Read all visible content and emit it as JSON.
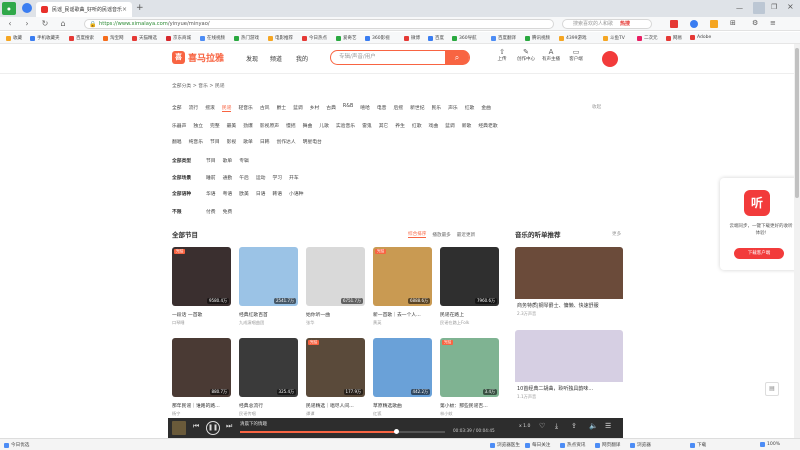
{
  "browser": {
    "tabs": [
      {
        "title": "民谣_民谣歌曲_好听的民谣音乐..."
      },
      {
        "title": "新标签页"
      }
    ],
    "url_scheme": "https://",
    "url_host": "www.ximalaya.com",
    "url_path": "/yinyue/minyao/",
    "search_placeholder": "搜索喜欢的人和歌",
    "hot_label": "热搜",
    "bookmarks": [
      "收藏",
      "手机收藏夹",
      "百度搜索",
      "淘宝网",
      "天猫精选",
      "京东商城",
      "在线视频",
      "热门游戏",
      "电影推荐",
      "今日热点",
      "爱奇艺",
      "360影视",
      "微博",
      "百度",
      "360导航",
      "百度翻译",
      "腾讯视频",
      "4399游戏",
      "斗鱼TV",
      "二次元",
      "网易",
      "Adobe"
    ]
  },
  "site": {
    "logo_text": "喜马拉雅",
    "logo_mark": "喜",
    "nav": [
      "发现",
      "频道",
      "我的"
    ],
    "search_placeholder": "专辑/声音/用户",
    "header_icons": [
      {
        "name": "上传",
        "icon": "upload-icon"
      },
      {
        "name": "创作中心",
        "icon": "create-icon"
      },
      {
        "name": "有声主播",
        "icon": "anchor-icon"
      },
      {
        "name": "客户端",
        "icon": "client-icon"
      }
    ],
    "breadcrumb": [
      "全部分类",
      "音乐",
      "民谣"
    ]
  },
  "categories": {
    "row1": [
      "全部",
      "流行",
      "摇滚",
      "民谣",
      "轻音乐",
      "古风",
      "爵士",
      "蓝调",
      "乡村",
      "古典",
      "R&B",
      "嘻哈",
      "电音",
      "后摇",
      "新世纪",
      "民乐",
      "声乐",
      "红歌",
      "金曲"
    ],
    "row1_active": "民谣",
    "row1_more": "收起",
    "row2": [
      "乐器声",
      "独立",
      "完整",
      "最美",
      "劲爆",
      "影视原声",
      "慢摇",
      "舞曲",
      "儿歌",
      "实验音乐",
      "雷鬼",
      "其它",
      "养生",
      "红歌",
      "戏曲",
      "蓝调",
      "新歌",
      "经典老歌"
    ],
    "row3": [
      "翻唱",
      "纯音乐",
      "节目",
      "影视",
      "歌单",
      "日韩",
      "创作达人",
      "明星电台"
    ],
    "filters": [
      {
        "label": "全部类型",
        "options": [
          "节目",
          "歌单",
          "专辑"
        ]
      },
      {
        "label": "全部场景",
        "options": [
          "睡前",
          "通勤",
          "午后",
          "运动",
          "学习",
          "开车"
        ]
      },
      {
        "label": "全部语种",
        "options": [
          "华语",
          "粤语",
          "欧美",
          "日语",
          "韩语",
          "小语种"
        ]
      },
      {
        "label": "不限",
        "options": [
          "付费",
          "免费"
        ]
      }
    ]
  },
  "section": {
    "title": "全部节目",
    "sorts": [
      "综合排序",
      "播放最多",
      "最近更新"
    ],
    "sort_active": "综合排序"
  },
  "albums": [
    {
      "title": "一段话 一首歌",
      "sub": "口琴睡",
      "count": "9580.4万",
      "tag": "完结",
      "color": "#3a2f2f"
    },
    {
      "title": "经典红歌百首",
      "sub": "九成演唱曲团",
      "count": "2541.7万",
      "tag": "",
      "color": "#9bc3e6"
    },
    {
      "title": "始你听一曲",
      "sub": "张华",
      "count": "6751.7万",
      "tag": "",
      "color": "#d9d9d9"
    },
    {
      "title": "新一首歌｜去一个人...",
      "sub": "黄英",
      "count": "6888.6万",
      "tag": "完结",
      "color": "#c99a52"
    },
    {
      "title": "民谣在路上",
      "sub": "民谣在路上Folk",
      "count": "7960.6万",
      "tag": "",
      "color": "#2f2f2f"
    },
    {
      "title": "那年民谣｜谁路的路...",
      "sub": "杨宁",
      "count": "880.7万",
      "tag": "",
      "color": "#4a3a34"
    },
    {
      "title": "经典总流行",
      "sub": "民谣传唱",
      "count": "325.4万",
      "tag": "",
      "color": "#3a3a3a"
    },
    {
      "title": "民谣精选｜唱尽人间...",
      "sub": "谭谭",
      "count": "177.9万",
      "tag": "完结",
      "color": "#5a4a3a"
    },
    {
      "title": "草原精选歌曲",
      "sub": "红狐",
      "count": "442.2万",
      "tag": "",
      "color": "#6aa1d8"
    },
    {
      "title": "第小蚊：那些民谣吉...",
      "sub": "林小蚊",
      "count": "3.4万",
      "tag": "完结",
      "color": "#7fb392"
    }
  ],
  "right_column": {
    "title": "音乐的听单推荐",
    "more": "更多",
    "items": [
      {
        "title": "商务特质|钢琴爵士、慵懒、快速舒服",
        "meta": "2.3万声音",
        "color": "#6b4b3a"
      },
      {
        "title": "10首经典二胡曲，聆听独具韵味...",
        "meta": "1.1万声音",
        "color": "#d6cfe3"
      }
    ]
  },
  "promo": {
    "icon": "听",
    "text": "云端同步，一键下载更好的收听体验!",
    "button": "下载客户端"
  },
  "player": {
    "track": "清晨下的情趣",
    "time": "00:03:39 / 00:04:45",
    "progress": 0.76,
    "speed": "x 1.0"
  },
  "statusbar": [
    "今日优选",
    "浏览器医生",
    "每日关注",
    "热点资讯",
    "网页翻译",
    "浏览器",
    "下载",
    "100%"
  ]
}
